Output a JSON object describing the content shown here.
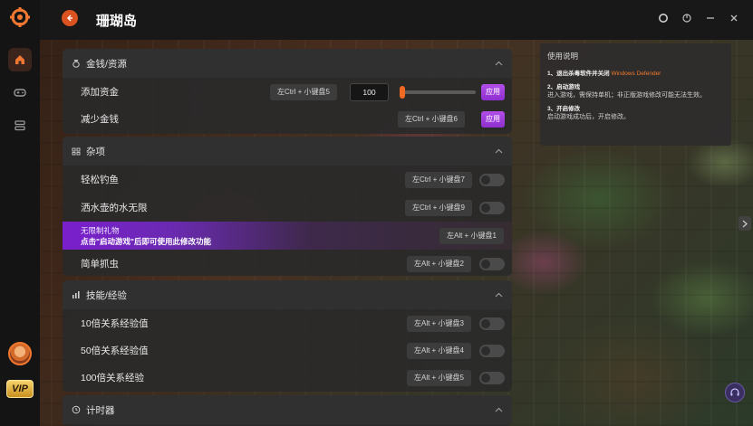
{
  "app": {
    "title": "珊瑚岛"
  },
  "sections": {
    "money": {
      "title": "金钱/资源",
      "rows": [
        {
          "label": "添加资金",
          "hotkey": "左Ctrl + 小键盘5",
          "value": "100",
          "apply": "应用",
          "slider_percent": 3
        },
        {
          "label": "减少金钱",
          "hotkey": "左Ctrl + 小键盘6",
          "apply": "应用"
        }
      ]
    },
    "misc": {
      "title": "杂项",
      "rows": [
        {
          "label": "轻松钓鱼",
          "hotkey": "左Ctrl + 小键盘7"
        },
        {
          "label": "洒水壶的水无限",
          "hotkey": "左Ctrl + 小键盘9"
        },
        {
          "label": "无限制礼物",
          "note": "点击\"启动游戏\"后即可使用此修改功能",
          "hotkey": "左Alt + 小键盘1"
        },
        {
          "label": "简单抓虫",
          "hotkey": "左Alt + 小键盘2"
        }
      ]
    },
    "skills": {
      "title": "技能/经验",
      "rows": [
        {
          "label": "10倍关系经验值",
          "hotkey": "左Alt + 小键盘3"
        },
        {
          "label": "50倍关系经验值",
          "hotkey": "左Alt + 小键盘4"
        },
        {
          "label": "100倍关系经验",
          "hotkey": "左Alt + 小键盘5"
        }
      ]
    },
    "timer": {
      "title": "计时器"
    }
  },
  "help": {
    "title": "使用说明",
    "step1_head": "1、退出杀毒软件并关闭",
    "step1_highlight": "Windows Defender",
    "step2_head": "2、启动游戏",
    "step2_body": "进入游戏，需保持单机；非正版游戏修改可能无法生效。",
    "step3_head": "3、开启修改",
    "step3_body": "启动游戏成功后，开启修改。"
  },
  "vip": {
    "label": "VIP"
  },
  "colors": {
    "accent": "#e8601c",
    "purple": "#9b3fe0",
    "bg": "#1c1410"
  },
  "icons": [
    "app-logo-icon",
    "home-icon",
    "gamepad-icon",
    "layers-icon",
    "back-arrow-icon",
    "circle-icon",
    "restore-icon",
    "minimize-icon",
    "close-icon",
    "money-bag-icon",
    "misc-icon",
    "chart-icon",
    "clock-icon",
    "chevron-up-icon",
    "chevron-right-icon",
    "headset-icon"
  ]
}
